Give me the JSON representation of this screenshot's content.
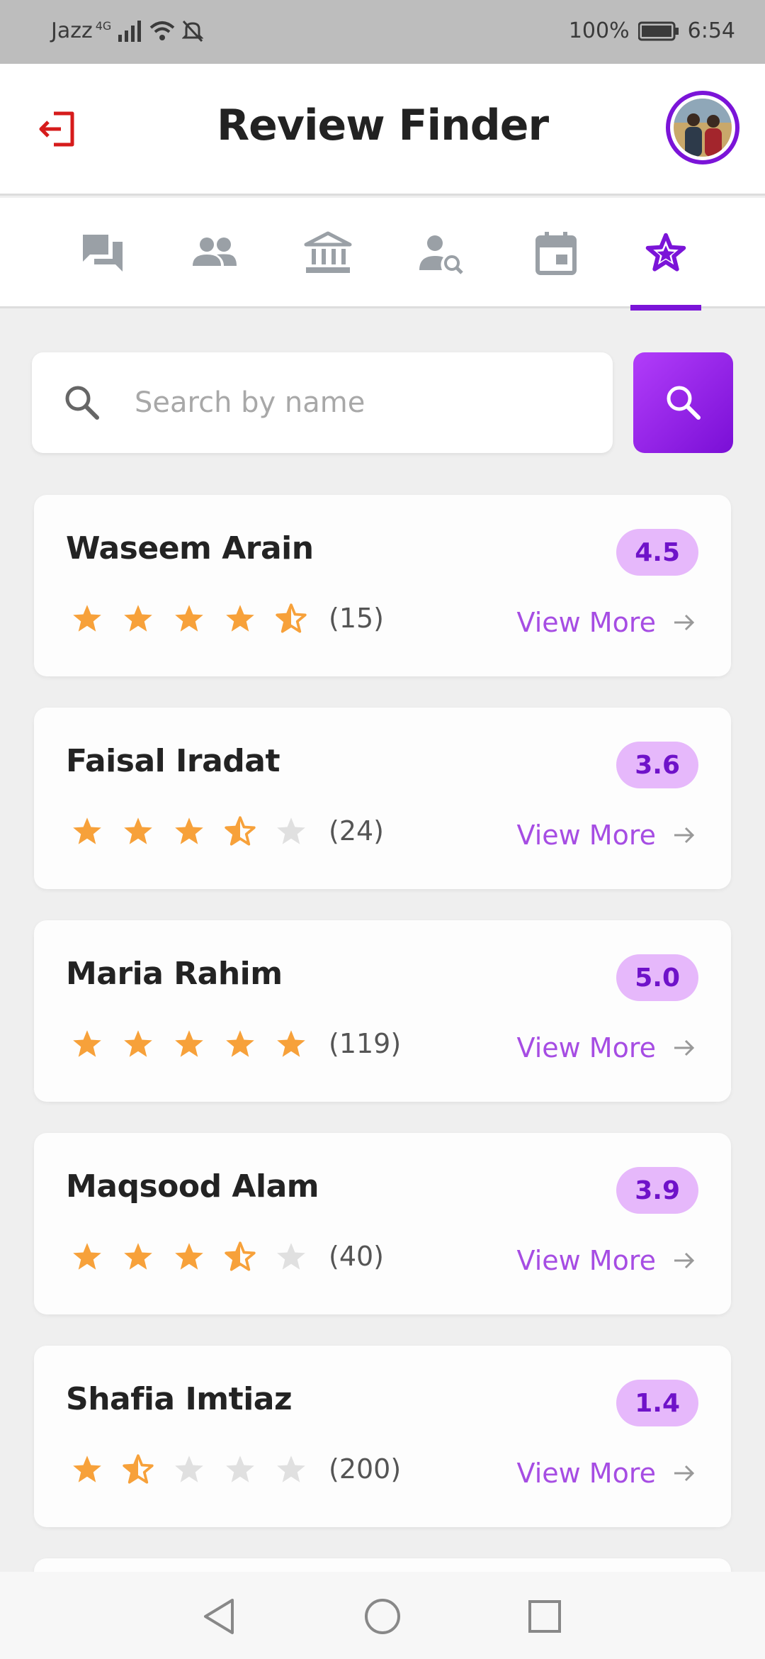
{
  "status_bar": {
    "carrier": "Jazz",
    "network": "4G",
    "battery": "100%",
    "time": "6:54"
  },
  "header": {
    "title": "Review Finder",
    "logout_icon": "logout-icon",
    "avatar_icon": "profile-photo"
  },
  "tabs": [
    {
      "icon": "chat-icon",
      "active": false
    },
    {
      "icon": "people-icon",
      "active": false
    },
    {
      "icon": "institution-icon",
      "active": false
    },
    {
      "icon": "person-search-icon",
      "active": false
    },
    {
      "icon": "calendar-icon",
      "active": false
    },
    {
      "icon": "star-icon",
      "active": true
    }
  ],
  "search": {
    "placeholder": "Search by name",
    "value": ""
  },
  "reviews": [
    {
      "name": "Waseem Arain",
      "rating": "4.5",
      "stars": 4.5,
      "count": "(15)",
      "link": "View More"
    },
    {
      "name": "Faisal Iradat",
      "rating": "3.6",
      "stars": 3.6,
      "count": "(24)",
      "link": "View More"
    },
    {
      "name": "Maria Rahim",
      "rating": "5.0",
      "stars": 5.0,
      "count": "(119)",
      "link": "View More"
    },
    {
      "name": "Maqsood Alam",
      "rating": "3.9",
      "stars": 3.9,
      "count": "(40)",
      "link": "View More"
    },
    {
      "name": "Shafia Imtiaz",
      "rating": "1.4",
      "stars": 1.4,
      "count": "(200)",
      "link": "View More"
    }
  ],
  "colors": {
    "accent": "#7b14d8",
    "star": "#f7a13a",
    "star_empty": "#e0e0e0",
    "badge_bg": "#e6b8fb"
  },
  "nav": {
    "back_icon": "back-icon",
    "home_icon": "home-icon",
    "recents_icon": "recents-icon"
  }
}
